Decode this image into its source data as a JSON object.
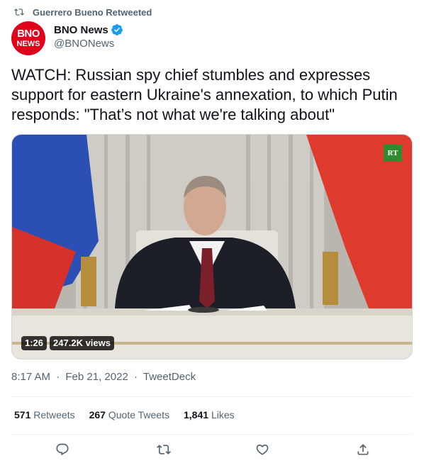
{
  "context": {
    "retweeted_by": "Guerrero Bueno Retweeted",
    "icon": "retweet-icon"
  },
  "author": {
    "avatar_top": "BNO",
    "avatar_bottom": "NEWS",
    "name": "BNO News",
    "handle": "@BNONews",
    "verified": true,
    "brand_color": "#e0001b"
  },
  "tweet": {
    "text": "WATCH: Russian spy chief stumbles and expresses support for eastern Ukraine's annexation, to which Putin responds: \"That’s not what we're talking about\""
  },
  "media": {
    "channel_logo": "RT",
    "duration": "1:26",
    "views": "247.2K views"
  },
  "meta": {
    "time": "8:17 AM",
    "date": "Feb 21, 2022",
    "source": "TweetDeck"
  },
  "stats": {
    "retweets_count": "571",
    "retweets_label": "Retweets",
    "quotes_count": "267",
    "quotes_label": "Quote Tweets",
    "likes_count": "1,841",
    "likes_label": "Likes"
  },
  "actions": {
    "reply": "reply-icon",
    "retweet": "retweet-icon",
    "like": "heart-icon",
    "share": "share-icon"
  },
  "colors": {
    "text_primary": "#0f1419",
    "text_secondary": "#536471",
    "divider": "#eff3f4",
    "verified": "#1d9bf0"
  }
}
